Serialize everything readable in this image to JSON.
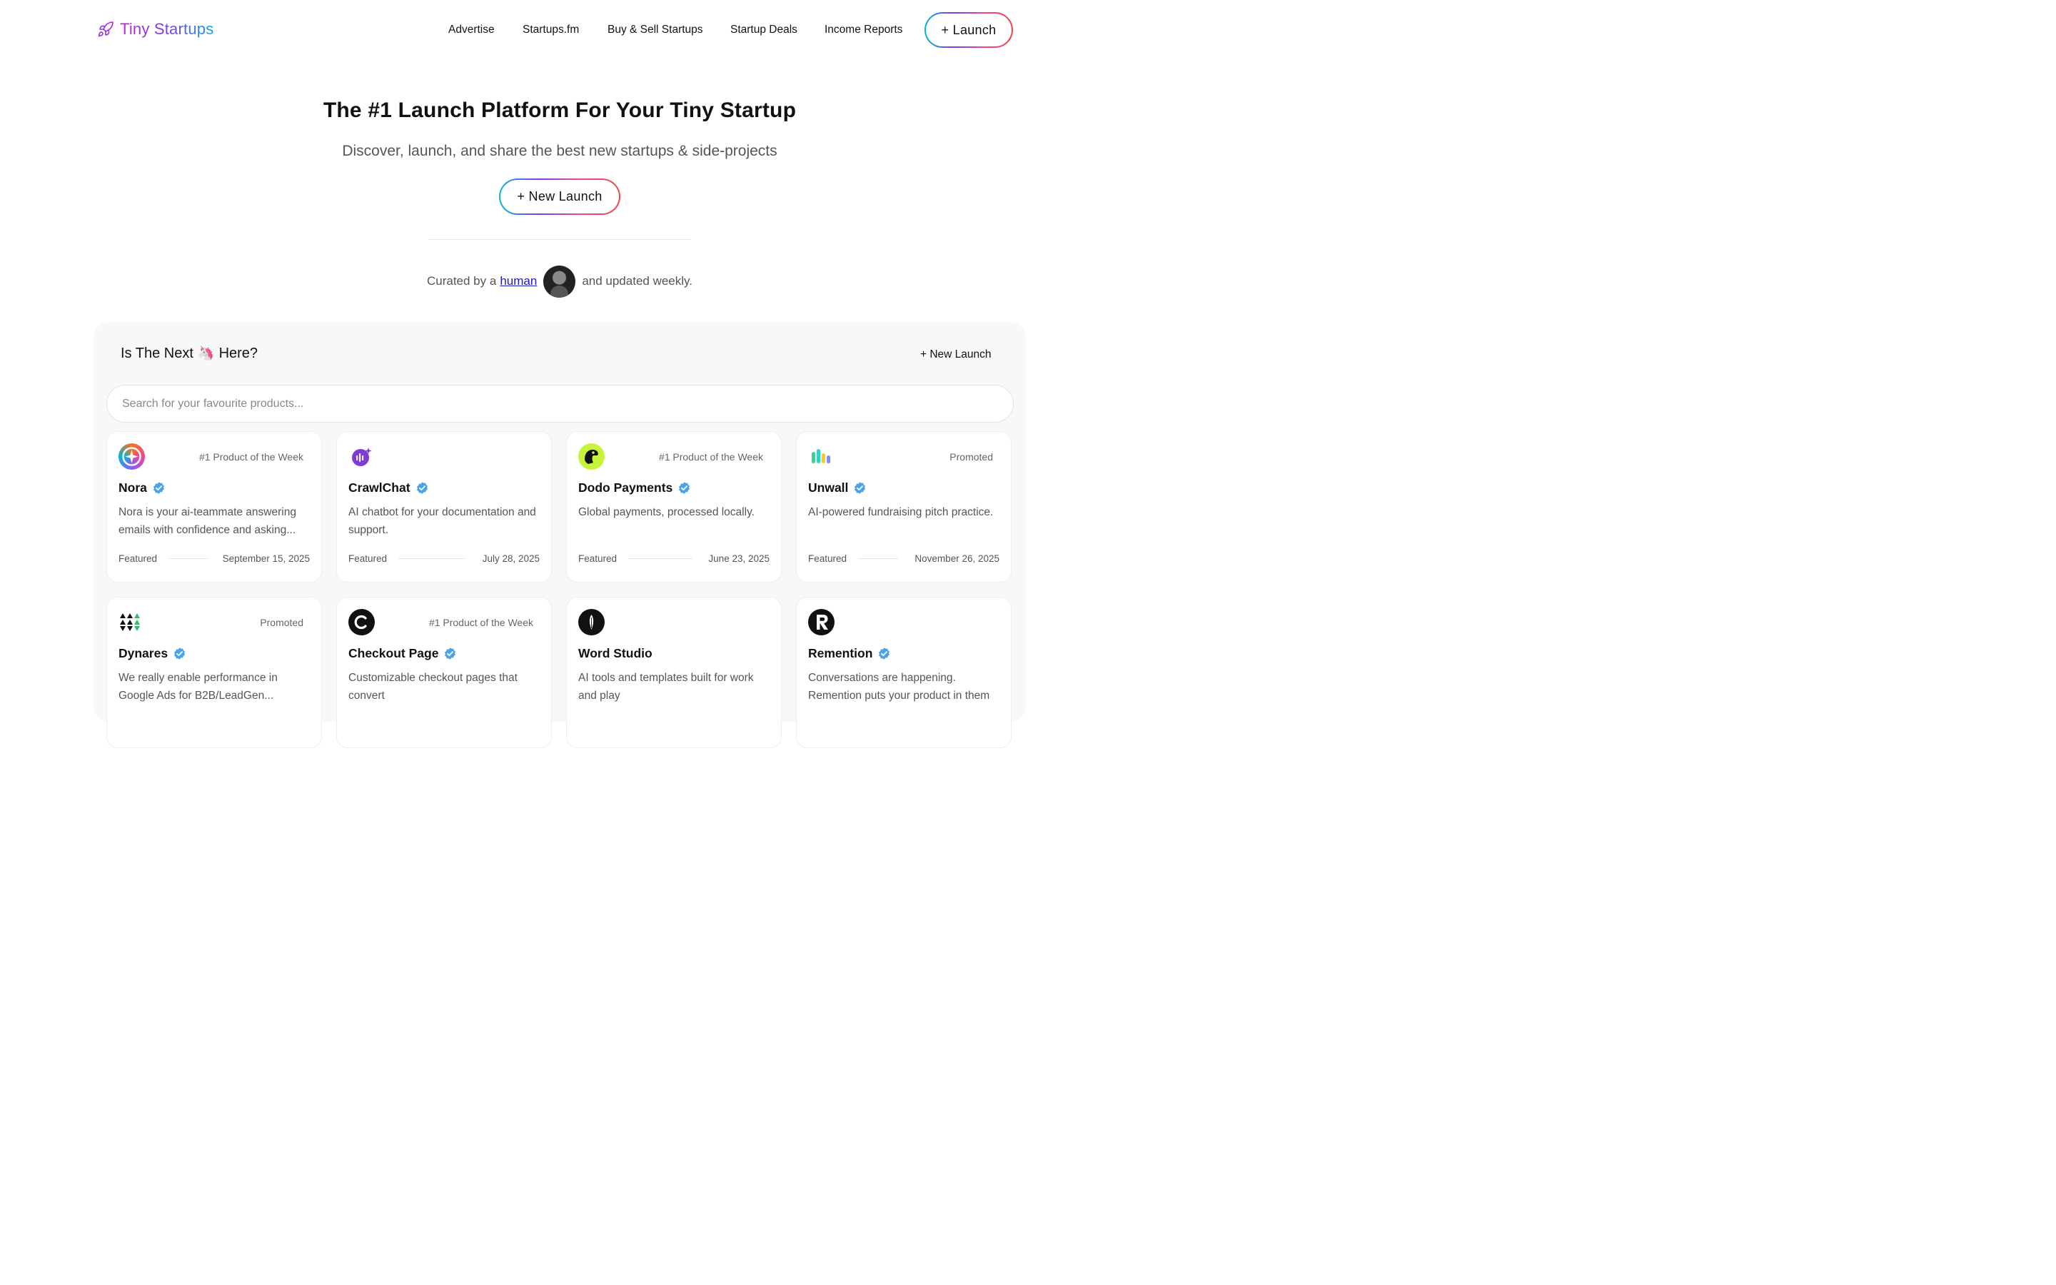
{
  "brand": {
    "name": "Tiny Startups"
  },
  "nav": {
    "items": [
      "Advertise",
      "Startups.fm",
      "Buy & Sell Startups",
      "Startup Deals",
      "Income Reports"
    ],
    "launch_label": "+ Launch"
  },
  "hero": {
    "title": "The #1 Launch Platform For Your Tiny Startup",
    "subtitle": "Discover, launch, and share the best new startups & side-projects",
    "cta_label": "+ New Launch",
    "curated_prefix": "Curated by a",
    "curated_link": "human",
    "curated_suffix": "and updated weekly."
  },
  "panel": {
    "title_before": "Is The Next",
    "title_emoji": "🦄",
    "title_after": "Here?",
    "new_launch_label": "+ New Launch",
    "search_placeholder": "Search for your favourite products..."
  },
  "cards": [
    {
      "name": "Nora",
      "verified": true,
      "badge": "#1 Product of the Week",
      "description": "Nora is your ai-teammate answering emails with confidence and asking...",
      "status": "Featured",
      "date": "September 15, 2025",
      "icon": "nora-logo-icon"
    },
    {
      "name": "CrawlChat",
      "verified": true,
      "badge": "",
      "description": "AI chatbot for your documentation and support.",
      "status": "Featured",
      "date": "July 28, 2025",
      "icon": "crawlchat-logo-icon"
    },
    {
      "name": "Dodo Payments",
      "verified": true,
      "badge": "#1 Product of the Week",
      "description": "Global payments, processed locally.",
      "status": "Featured",
      "date": "June 23, 2025",
      "icon": "dodo-logo-icon"
    },
    {
      "name": "Unwall",
      "verified": true,
      "badge": "Promoted",
      "description": "AI-powered fundraising pitch practice.",
      "status": "Featured",
      "date": "November 26, 2025",
      "icon": "unwall-logo-icon"
    },
    {
      "name": "Dynares",
      "verified": true,
      "badge": "Promoted",
      "description": "We really enable performance in Google Ads for B2B/LeadGen...",
      "status": "",
      "date": "",
      "icon": "dynares-logo-icon"
    },
    {
      "name": "Checkout Page",
      "verified": true,
      "badge": "#1 Product of the Week",
      "description": "Customizable checkout pages that convert",
      "status": "",
      "date": "",
      "icon": "checkout-page-logo-icon"
    },
    {
      "name": "Word Studio",
      "verified": false,
      "badge": "",
      "description": "AI tools and templates built for work and play",
      "status": "",
      "date": "",
      "icon": "word-studio-logo-icon"
    },
    {
      "name": "Remention",
      "verified": true,
      "badge": "",
      "description": "Conversations are happening. Remention puts your product in them",
      "status": "",
      "date": "",
      "icon": "remention-logo-icon"
    }
  ],
  "colors": {
    "accent_gradient": [
      "#06b6d4",
      "#7c3aed",
      "#ec4899",
      "#ef4444"
    ],
    "brand_gradient": [
      "#c026d3",
      "#7c3aed",
      "#0ea5e9"
    ],
    "verified": "#4aa3e8",
    "link": "#1d1ab5"
  }
}
